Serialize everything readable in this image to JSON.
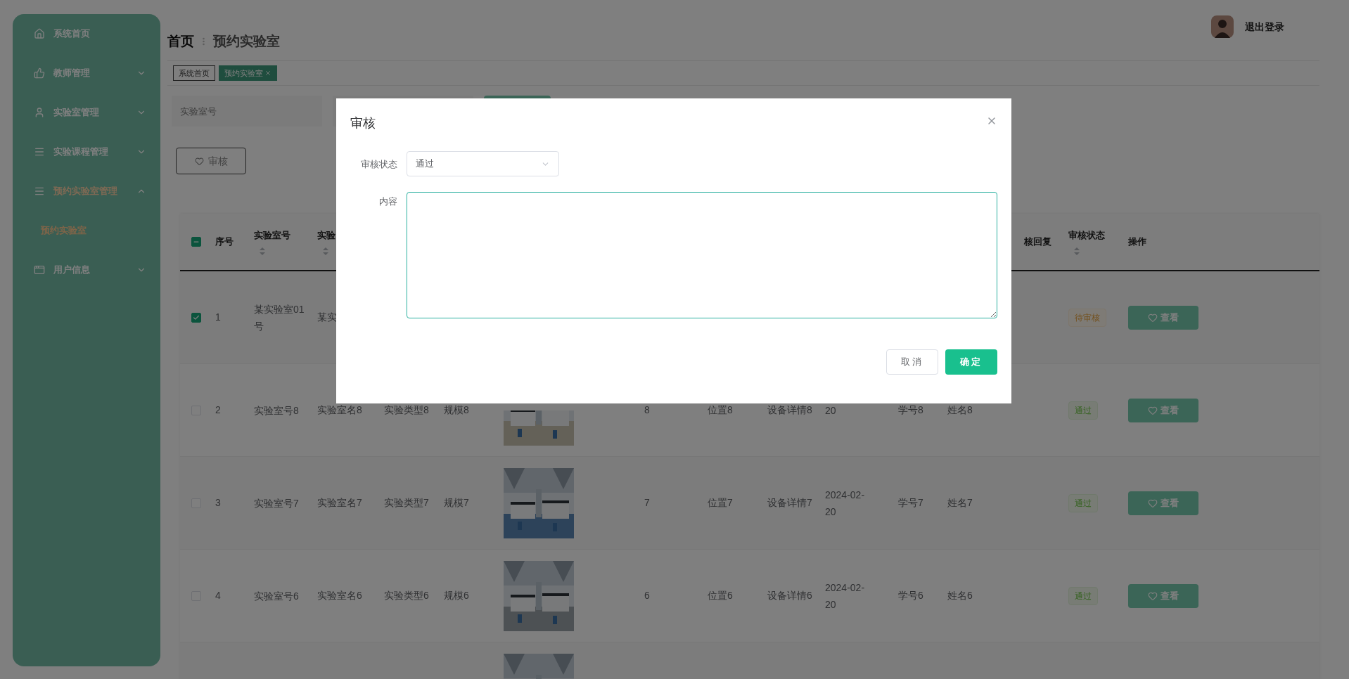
{
  "sidebar": {
    "items": [
      {
        "kind": "link",
        "label": "系统首页"
      },
      {
        "kind": "menu",
        "label": "教师管理",
        "expanded": false
      },
      {
        "kind": "menu",
        "label": "实验室管理",
        "expanded": false
      },
      {
        "kind": "menu",
        "label": "实验课程管理",
        "expanded": false
      },
      {
        "kind": "menu",
        "label": "预约实验室管理",
        "expanded": true,
        "children": [
          {
            "label": "预约实验室",
            "selected": true
          }
        ]
      },
      {
        "kind": "menu",
        "label": "用户信息",
        "expanded": false
      }
    ]
  },
  "header": {
    "breadcrumb": [
      "首页",
      "预约实验室"
    ],
    "logout": "退出登录"
  },
  "tabs": [
    {
      "label": "系统首页",
      "selected": false,
      "closable": false
    },
    {
      "label": "预约实验室",
      "selected": true,
      "closable": true
    }
  ],
  "search": {
    "placeholder": "实验室号"
  },
  "toolbar": {
    "review_button": "审核"
  },
  "table": {
    "indeterminate": true,
    "headers": [
      {
        "label": "序号",
        "sortable": false
      },
      {
        "label": "实验室号",
        "sortable": true
      },
      {
        "label": "实验",
        "sortable": true
      },
      {
        "label": "核回复",
        "sortable": false
      },
      {
        "label": "审核状态",
        "sortable": true
      },
      {
        "label": "操作",
        "sortable": false
      }
    ],
    "rows": [
      {
        "checked": true,
        "index": "1",
        "lab_no": "某实验室01号",
        "lab_name": "某实",
        "status": {
          "label": "待审核",
          "kind": "pending"
        },
        "action": "查看"
      },
      {
        "checked": false,
        "index": "2",
        "lab_no": "实验室号8",
        "lab_name": "实验室名8",
        "type": "实验类型8",
        "scale": "规模8",
        "image": {
          "kind": "picture"
        },
        "capacity": "8",
        "location": "位置8",
        "equipment": "设备详情8",
        "date": "20",
        "student_no": "学号8",
        "name": "姓名8",
        "status": {
          "label": "通过",
          "kind": "passed"
        },
        "action": "查看"
      },
      {
        "checked": false,
        "index": "3",
        "lab_no": "实验室号7",
        "lab_name": "实验室名7",
        "type": "实验类型7",
        "scale": "规模7",
        "image": {
          "kind": "picture"
        },
        "capacity": "7",
        "location": "位置7",
        "equipment": "设备详情7",
        "date": "2024-02-20",
        "student_no": "学号7",
        "name": "姓名7",
        "status": {
          "label": "通过",
          "kind": "passed"
        },
        "action": "查看"
      },
      {
        "checked": false,
        "index": "4",
        "lab_no": "实验室号6",
        "lab_name": "实验室名6",
        "type": "实验类型6",
        "scale": "规模6",
        "image": {
          "kind": "picture"
        },
        "capacity": "6",
        "location": "位置6",
        "equipment": "设备详情6",
        "date": "2024-02-20",
        "student_no": "学号6",
        "name": "姓名6",
        "status": {
          "label": "通过",
          "kind": "passed"
        },
        "action": "查看"
      },
      {
        "image": {
          "kind": "picture"
        }
      }
    ]
  },
  "modal": {
    "title": "审核",
    "fields": [
      {
        "kind": "select",
        "label": "审核状态",
        "value": "通过"
      },
      {
        "kind": "textarea",
        "label": "内容"
      }
    ],
    "buttons": [
      {
        "kind": "secondary",
        "label": "取消"
      },
      {
        "kind": "primary",
        "label": "确定"
      }
    ]
  }
}
